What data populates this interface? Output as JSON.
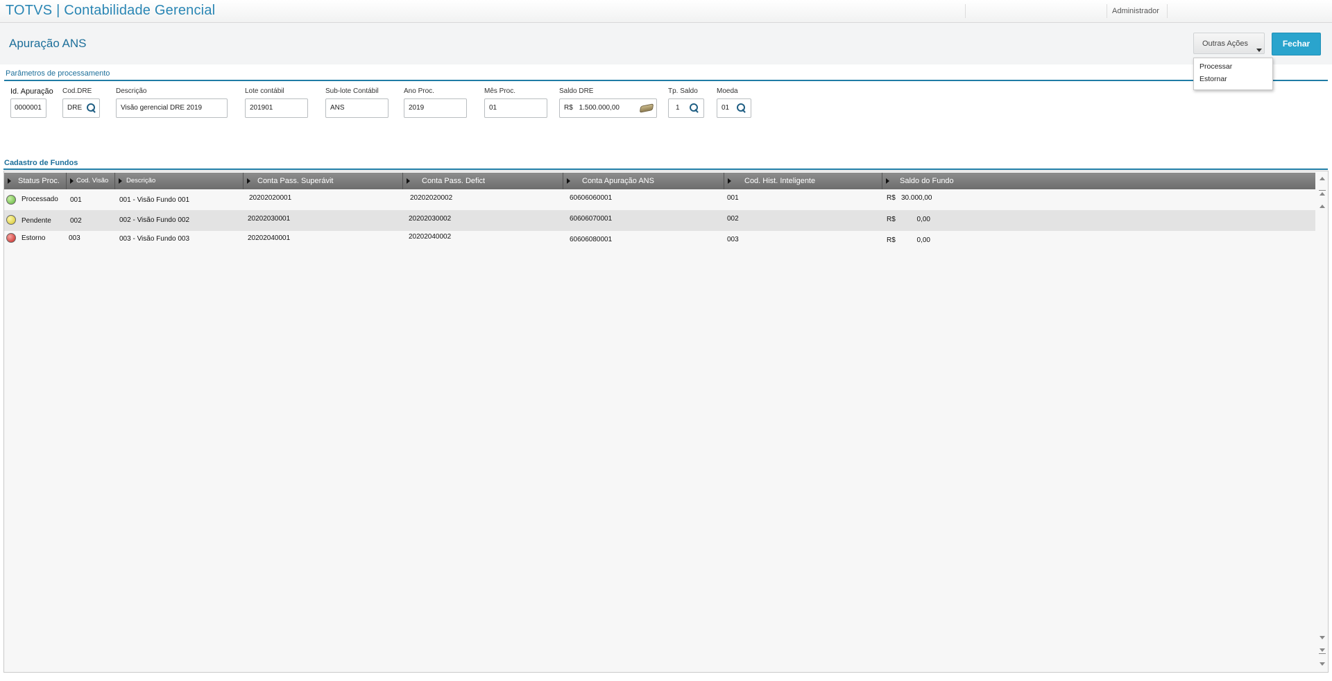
{
  "app": {
    "title": "TOTVS | Contabilidade Gerencial",
    "user": "Administrador"
  },
  "page": {
    "title": "Apuração ANS"
  },
  "actions": {
    "outras_label": "Outras Ações",
    "fechar_label": "Fechar",
    "menu": [
      "Processar",
      "Estornar"
    ]
  },
  "params": {
    "section_title": "Parâmetros de processamento",
    "fields": {
      "id_apuracao": {
        "label": "Id. Apuração",
        "value": "0000001"
      },
      "cod_dre": {
        "label": "Cod.DRE",
        "value": "DRE"
      },
      "descricao": {
        "label": "Descrição",
        "value": "Visão gerencial DRE 2019"
      },
      "lote": {
        "label": "Lote contábil",
        "value": "201901"
      },
      "sublote": {
        "label": "Sub-lote Contábil",
        "value": "ANS"
      },
      "ano": {
        "label": "Ano Proc.",
        "value": "2019"
      },
      "mes": {
        "label": "Mês Proc.",
        "value": "01"
      },
      "saldo_dre": {
        "label": "Saldo DRE",
        "currency": "R$",
        "value": "1.500.000,00"
      },
      "tp_saldo": {
        "label": "Tp. Saldo",
        "value": "1"
      },
      "moeda": {
        "label": "Moeda",
        "value": "01"
      }
    }
  },
  "grid": {
    "section_title": "Cadastro de Fundos",
    "columns": [
      "Status Proc.",
      "Cod. Visão",
      "Descrição",
      "Conta Pass. Superávit",
      "Conta Pass. Defict",
      "Conta Apuração ANS",
      "Cod. Hist. Inteligente",
      "Saldo do Fundo"
    ],
    "rows": [
      {
        "status": "Processado",
        "status_color": "#6cc24a",
        "cod": "001",
        "desc": "001 -  Visão Fundo 001",
        "superavit": "20202020001",
        "deficit": "20202020002",
        "apuracao": "60606060001",
        "hist": "001",
        "currency": "R$",
        "saldo": "30.000,00"
      },
      {
        "status": "Pendente",
        "status_color": "#e6d83a",
        "cod": "002",
        "desc": "002 - Visão Fundo 002",
        "superavit": "20202030001",
        "deficit": "20202030002",
        "apuracao": "60606070001",
        "hist": "002",
        "currency": "R$",
        "saldo": "0,00"
      },
      {
        "status": "Estorno",
        "status_color": "#d9322e",
        "cod": "003",
        "desc": "003 - Visão Fundo 003",
        "superavit": "20202040001",
        "deficit": "20202040002",
        "apuracao": "60606080001",
        "hist": "003",
        "currency": "R$",
        "saldo": "0,00"
      }
    ]
  }
}
